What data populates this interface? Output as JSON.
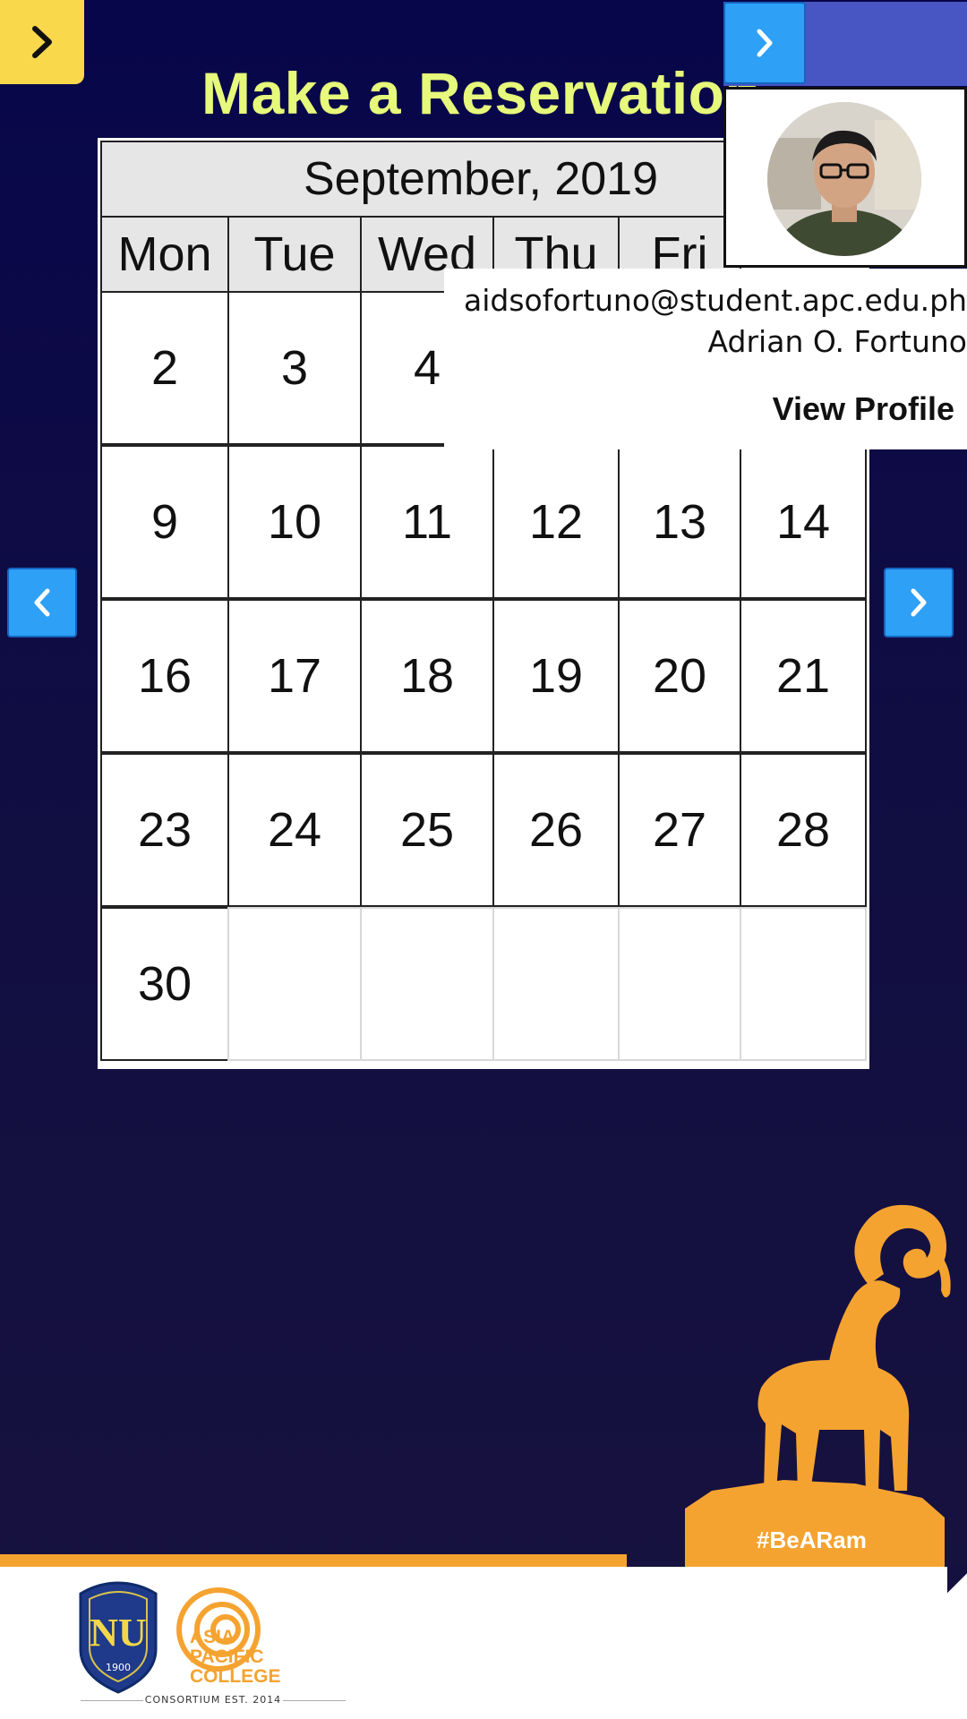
{
  "page": {
    "title": "Make a Reservation"
  },
  "calendar": {
    "month_label": "September, 2019",
    "weekdays": [
      "Mon",
      "Tue",
      "Wed",
      "Thu",
      "Fri"
    ],
    "rows": [
      [
        "2",
        "3",
        "4",
        "",
        "",
        ""
      ],
      [
        "9",
        "10",
        "11",
        "12",
        "13",
        "14"
      ],
      [
        "16",
        "17",
        "18",
        "19",
        "20",
        "21"
      ],
      [
        "23",
        "24",
        "25",
        "26",
        "27",
        "28"
      ],
      [
        "30",
        "",
        "",
        "",
        "",
        ""
      ]
    ]
  },
  "profile": {
    "email": "aidsofortuno@student.apc.edu.ph",
    "name": "Adrian O. Fortuno",
    "view_profile_label": "View Profile"
  },
  "footer": {
    "hashtag": "#BeARam",
    "nu_year": "1900",
    "apc_lines": [
      "ASIA",
      "PACIFIC",
      "COLLEGE"
    ],
    "consortium": "CONSORTIUM EST. 2014"
  },
  "icons": {
    "menu": "chevron-right-icon",
    "prev": "chevron-left-icon",
    "next": "chevron-right-icon"
  },
  "colors": {
    "accent_yellow": "#f9d84c",
    "title_green": "#e6f97a",
    "button_blue": "#2ea0f5",
    "profile_bar": "#4756c2",
    "ram_orange": "#f5a330"
  }
}
